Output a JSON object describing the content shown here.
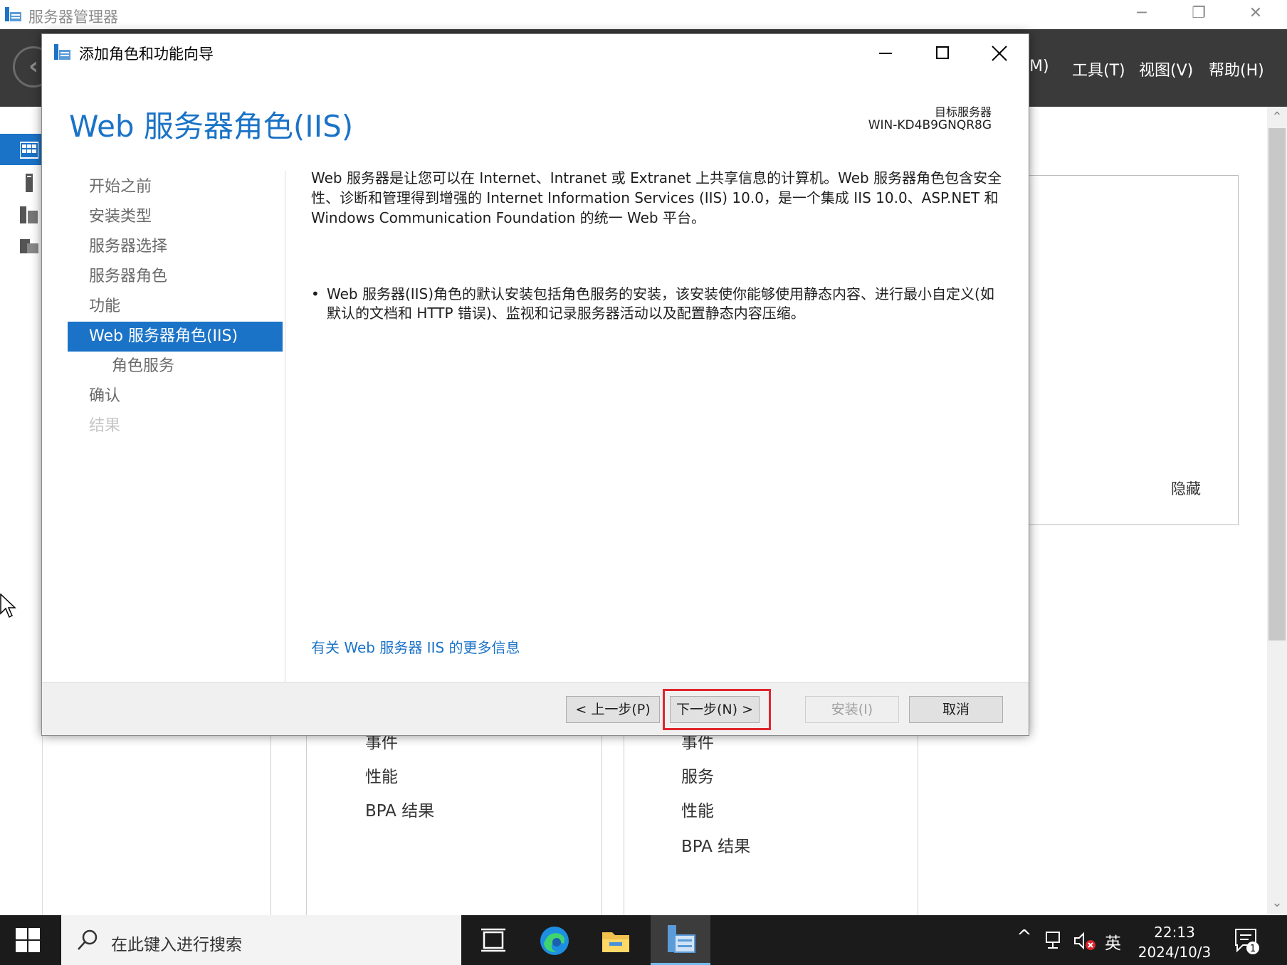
{
  "server_manager": {
    "title": "服务器管理器",
    "menu": [
      "M)",
      "工具(T)",
      "视图(V)",
      "帮助(H)"
    ],
    "hide_label": "隐藏",
    "tile_left": [
      "事件",
      "性能",
      "BPA 结果"
    ],
    "tile_right": [
      "事件",
      "服务",
      "性能",
      "BPA 结果"
    ]
  },
  "wizard": {
    "title": "添加角色和功能向导",
    "heading": "Web 服务器角色(IIS)",
    "target_label": "目标服务器",
    "target_name": "WIN-KD4B9GNQR8G",
    "steps": [
      {
        "label": "开始之前",
        "state": "normal"
      },
      {
        "label": "安装类型",
        "state": "normal"
      },
      {
        "label": "服务器选择",
        "state": "normal"
      },
      {
        "label": "服务器角色",
        "state": "normal"
      },
      {
        "label": "功能",
        "state": "normal"
      },
      {
        "label": "Web 服务器角色(IIS)",
        "state": "active"
      },
      {
        "label": "角色服务",
        "state": "sub"
      },
      {
        "label": "确认",
        "state": "normal"
      },
      {
        "label": "结果",
        "state": "disabled"
      }
    ],
    "description": "Web 服务器是让您可以在 Internet、Intranet 或 Extranet 上共享信息的计算机。Web 服务器角色包含安全性、诊断和管理得到增强的 Internet Information Services (IIS) 10.0，是一个集成 IIS 10.0、ASP.NET 和 Windows Communication Foundation 的统一 Web 平台。",
    "bullet_symbol": "•",
    "bullet": "Web 服务器(IIS)角色的默认安装包括角色服务的安装，该安装使你能够使用静态内容、进行最小自定义(如默认的文档和 HTTP 错误)、监视和记录服务器活动以及配置静态内容压缩。",
    "more_info_link": "有关 Web 服务器 IIS 的更多信息",
    "buttons": {
      "prev": "< 上一步(P)",
      "next": "下一步(N) >",
      "install": "安装(I)",
      "cancel": "取消"
    }
  },
  "taskbar": {
    "search_placeholder": "在此键入进行搜索",
    "ime": "英",
    "time": "22:13",
    "date": "2024/10/3",
    "notification_count": "1"
  }
}
